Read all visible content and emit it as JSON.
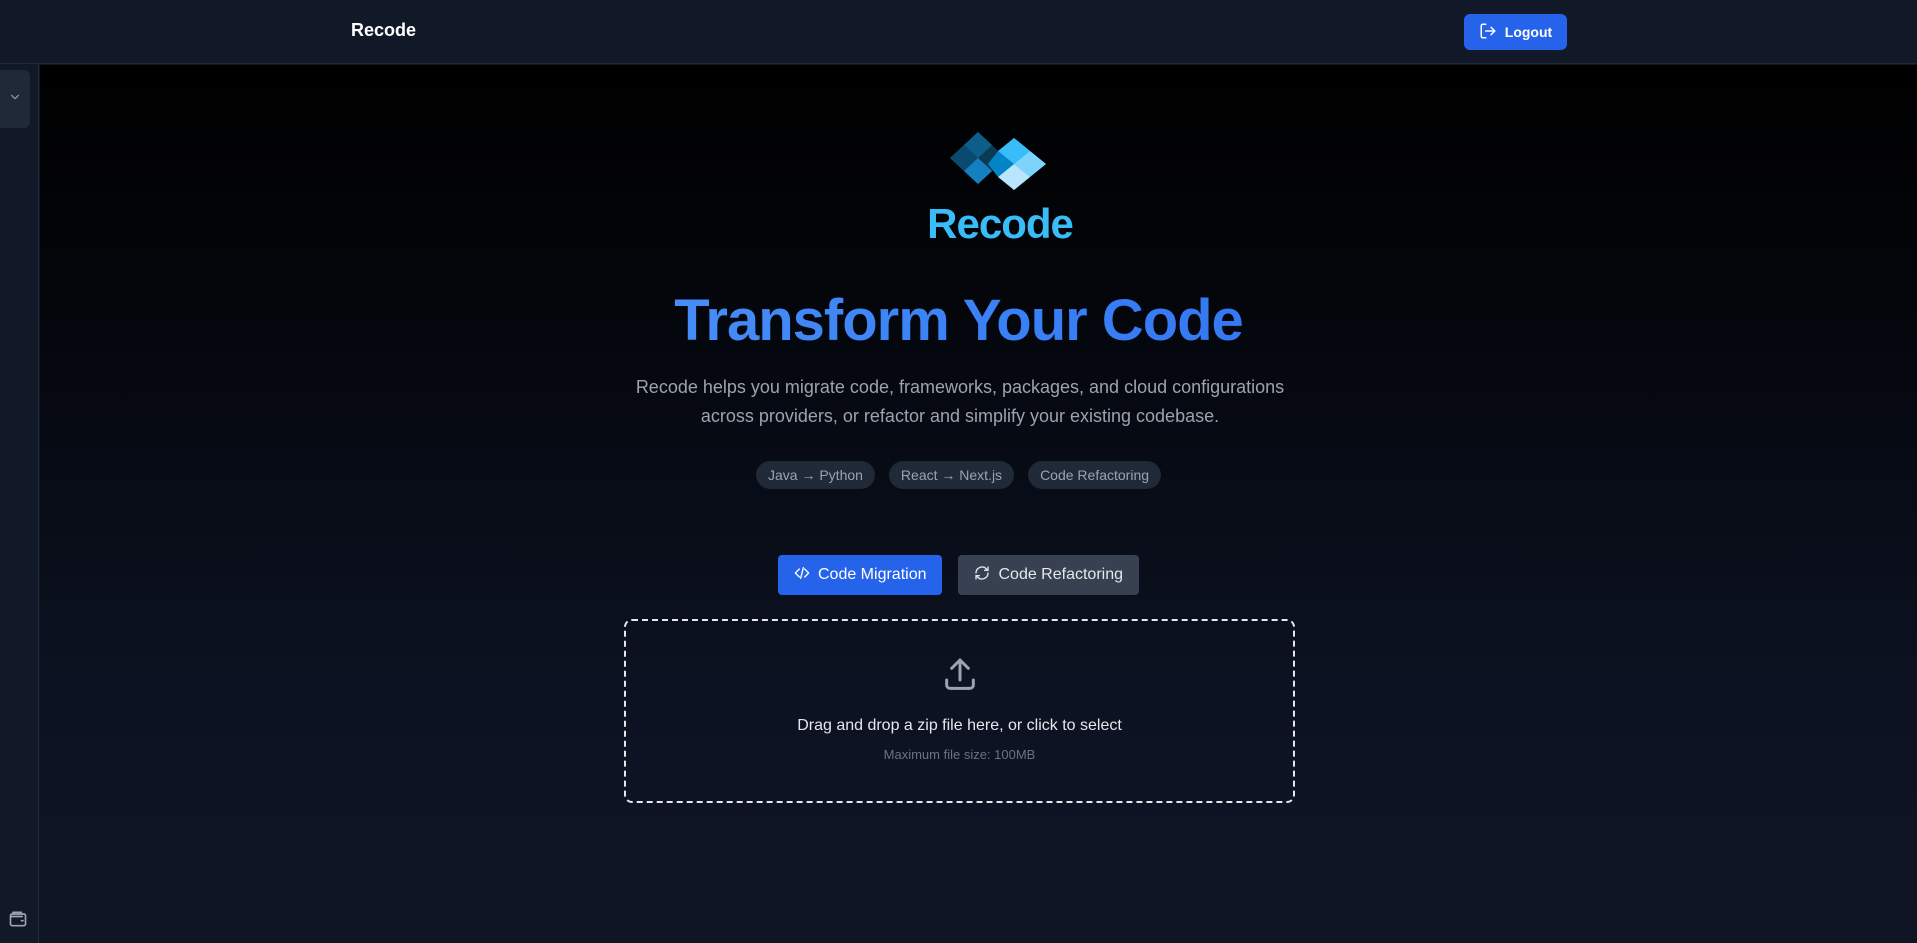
{
  "header": {
    "brand": "Recode",
    "logout_label": "Logout"
  },
  "sidebar": {
    "toggle_icon": "chevron-down-icon",
    "footer_icon": "wallet-icon"
  },
  "hero": {
    "logo_text": "Recode",
    "title": "Transform Your Code",
    "description": "Recode helps you migrate code, frameworks, packages, and cloud configurations across providers, or refactor and simplify your existing codebase.",
    "tags": [
      "Java → Python",
      "React → Next.js",
      "Code Refactoring"
    ]
  },
  "modes": {
    "migration_label": "Code Migration",
    "refactoring_label": "Code Refactoring",
    "active": "migration"
  },
  "upload": {
    "title": "Drag and drop a zip file here, or click to select",
    "subtitle": "Maximum file size: 100MB"
  },
  "colors": {
    "accent": "#2563eb",
    "logo": "#38bdf8",
    "background": "#0f1525"
  }
}
